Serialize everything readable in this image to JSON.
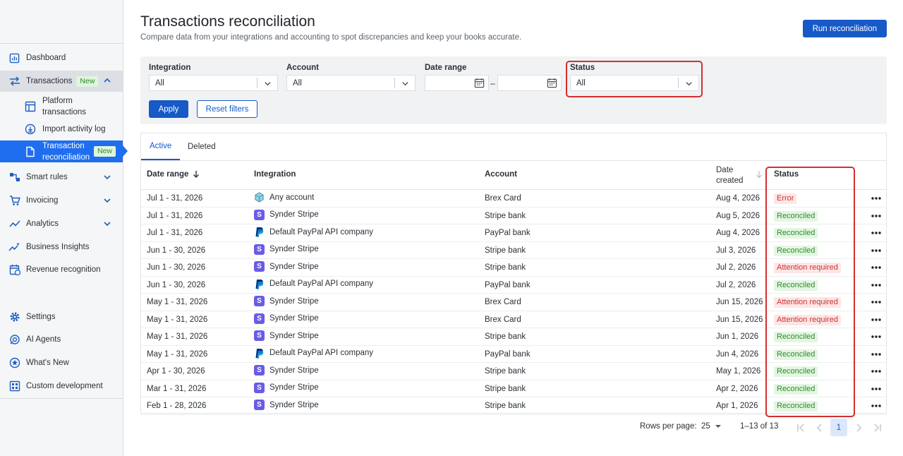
{
  "sidebar": {
    "items": [
      {
        "label": "Dashboard"
      },
      {
        "label": "Transactions",
        "badge": "New"
      },
      {
        "label": "Smart rules"
      },
      {
        "label": "Invoicing"
      },
      {
        "label": "Analytics"
      },
      {
        "label": "Business Insights"
      },
      {
        "label": "Revenue recognition"
      },
      {
        "label": "Settings"
      },
      {
        "label": "AI Agents"
      },
      {
        "label": "What's New"
      },
      {
        "label": "Custom development"
      }
    ],
    "sub_items": [
      {
        "label_line1": "Platform",
        "label_line2": "transactions"
      },
      {
        "label": "Import activity log"
      },
      {
        "label_line1": "Transaction",
        "label_line2": "reconciliation",
        "badge": "New"
      }
    ]
  },
  "page": {
    "title": "Transactions reconciliation",
    "subtitle": "Compare data from your integrations and accounting to spot discrepancies and keep your books accurate.",
    "run_button": "Run reconciliation"
  },
  "filters": {
    "integration": {
      "label": "Integration",
      "value": "All"
    },
    "account": {
      "label": "Account",
      "value": "All"
    },
    "date_range": {
      "label": "Date range",
      "separator": "–"
    },
    "status": {
      "label": "Status",
      "value": "All"
    },
    "apply": "Apply",
    "reset": "Reset filters"
  },
  "tabs": [
    "Active",
    "Deleted"
  ],
  "table": {
    "headers": {
      "date_range": "Date range",
      "integration": "Integration",
      "account": "Account",
      "date_created_1": "Date",
      "date_created_2": "created",
      "status": "Status"
    },
    "rows": [
      {
        "date_range": "Jul 1 - 31, 2026",
        "integration": "Any account",
        "logo": "any",
        "account": "Brex Card",
        "created": "Aug 4, 2026",
        "status": "Error",
        "kind": "bad"
      },
      {
        "date_range": "Jul 1 - 31, 2026",
        "integration": "Synder Stripe",
        "logo": "stripe",
        "account": "Stripe bank",
        "created": "Aug 5, 2026",
        "status": "Reconciled",
        "kind": "ok"
      },
      {
        "date_range": "Jul 1 - 31, 2026",
        "integration": "Default PayPal API company",
        "logo": "paypal",
        "account": "PayPal bank",
        "created": "Aug 4, 2026",
        "status": "Reconciled",
        "kind": "ok"
      },
      {
        "date_range": "Jun 1 - 30, 2026",
        "integration": "Synder Stripe",
        "logo": "stripe",
        "account": "Stripe bank",
        "created": "Jul 3, 2026",
        "status": "Reconciled",
        "kind": "ok"
      },
      {
        "date_range": "Jun 1 - 30, 2026",
        "integration": "Synder Stripe",
        "logo": "stripe",
        "account": "Stripe bank",
        "created": "Jul 2, 2026",
        "status": "Attention required",
        "kind": "bad"
      },
      {
        "date_range": "Jun 1 - 30, 2026",
        "integration": "Default PayPal API company",
        "logo": "paypal",
        "account": "PayPal bank",
        "created": "Jul 2, 2026",
        "status": "Reconciled",
        "kind": "ok"
      },
      {
        "date_range": "May 1 - 31, 2026",
        "integration": "Synder Stripe",
        "logo": "stripe",
        "account": "Brex Card",
        "created": "Jun 15, 2026",
        "status": "Attention required",
        "kind": "bad"
      },
      {
        "date_range": "May 1 - 31, 2026",
        "integration": "Synder Stripe",
        "logo": "stripe",
        "account": "Brex Card",
        "created": "Jun 15, 2026",
        "status": "Attention required",
        "kind": "bad"
      },
      {
        "date_range": "May 1 - 31, 2026",
        "integration": "Synder Stripe",
        "logo": "stripe",
        "account": "Stripe bank",
        "created": "Jun 1, 2026",
        "status": "Reconciled",
        "kind": "ok"
      },
      {
        "date_range": "May 1 - 31, 2026",
        "integration": "Default PayPal API company",
        "logo": "paypal",
        "account": "PayPal bank",
        "created": "Jun 4, 2026",
        "status": "Reconciled",
        "kind": "ok"
      },
      {
        "date_range": "Apr 1 - 30, 2026",
        "integration": "Synder Stripe",
        "logo": "stripe",
        "account": "Stripe bank",
        "created": "May 1, 2026",
        "status": "Reconciled",
        "kind": "ok"
      },
      {
        "date_range": "Mar 1 - 31, 2026",
        "integration": "Synder Stripe",
        "logo": "stripe",
        "account": "Stripe bank",
        "created": "Apr 2, 2026",
        "status": "Reconciled",
        "kind": "ok"
      },
      {
        "date_range": "Feb 1 - 28, 2026",
        "integration": "Synder Stripe",
        "logo": "stripe",
        "account": "Stripe bank",
        "created": "Apr 1, 2026",
        "status": "Reconciled",
        "kind": "ok"
      }
    ]
  },
  "pagination": {
    "rows_per_page_label": "Rows per page:",
    "rows_per_page": "25",
    "range": "1–13 of 13",
    "current_page": "1"
  },
  "colors": {
    "primary": "#1659c7",
    "active_nav": "#1f6ef0",
    "highlight": "#d32f2f"
  }
}
